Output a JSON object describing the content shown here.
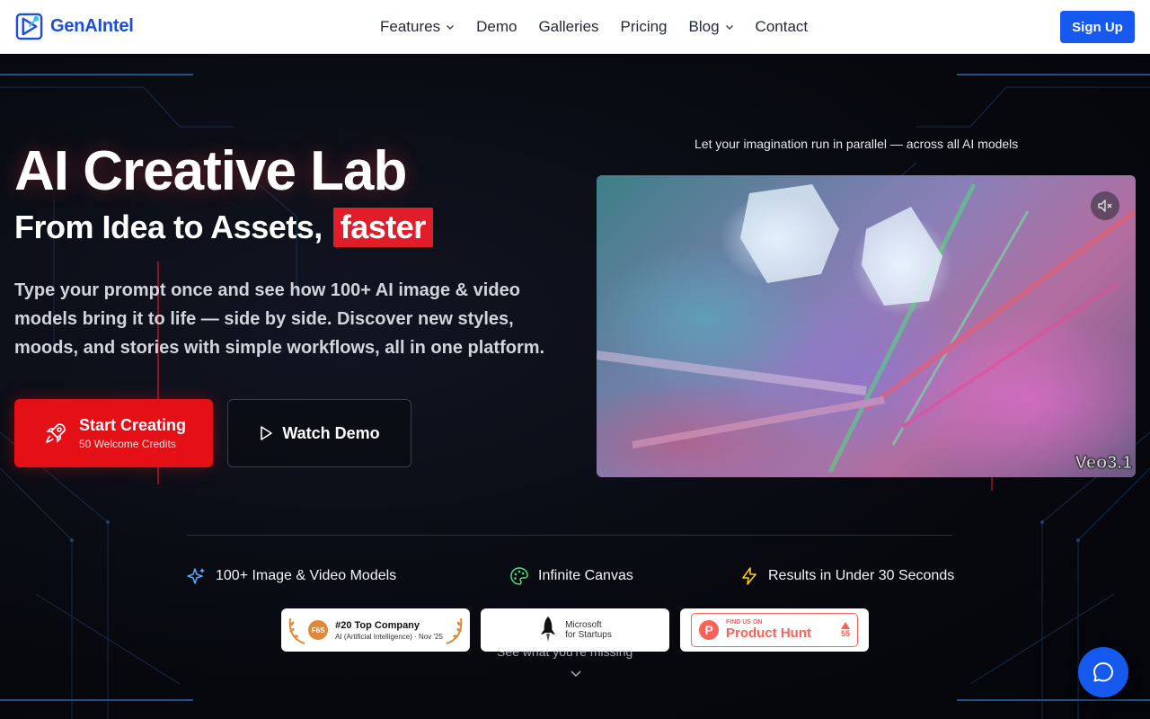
{
  "nav": {
    "brand": "GenAIntel",
    "items": [
      {
        "label": "Features",
        "dropdown": true
      },
      {
        "label": "Demo",
        "dropdown": false
      },
      {
        "label": "Galleries",
        "dropdown": false
      },
      {
        "label": "Pricing",
        "dropdown": false
      },
      {
        "label": "Blog",
        "dropdown": true
      },
      {
        "label": "Contact",
        "dropdown": false
      }
    ],
    "signup_label": "Sign Up"
  },
  "hero": {
    "tagline": "Let your imagination run in parallel — across all AI models",
    "title": "AI Creative Lab",
    "subtitle_prefix": "From Idea to Assets,",
    "subtitle_highlight": "faster",
    "description": "Type your prompt once and see how 100+ AI image & video models bring it to life — side by side. Discover new styles, moods, and stories with simple workflows, all in one platform.",
    "primary_cta": {
      "label": "Start Creating",
      "sublabel": "50 Welcome Credits"
    },
    "secondary_cta": {
      "label": "Watch Demo"
    }
  },
  "video": {
    "model_label": "Veo3.1"
  },
  "features": [
    {
      "icon": "sparkles-icon",
      "label": "100+ Image & Video Models"
    },
    {
      "icon": "palette-icon",
      "label": "Infinite Canvas"
    },
    {
      "icon": "lightning-icon",
      "label": "Results in Under 30 Seconds"
    }
  ],
  "badges": {
    "f6s": {
      "logo": "F6S",
      "title": "#20 Top Company",
      "detail": "AI (Artificial Intelligence) · Nov '25"
    },
    "microsoft": {
      "line1": "Microsoft",
      "line2": "for Startups"
    },
    "producthunt": {
      "small": "FIND US ON",
      "big": "Product Hunt",
      "logo": "P",
      "votes": "55"
    }
  },
  "scroll_hint": "See what you're missing",
  "colors": {
    "accent": "#1559ee",
    "highlight": "#e11d2a",
    "primary_button": "#e50f16"
  }
}
